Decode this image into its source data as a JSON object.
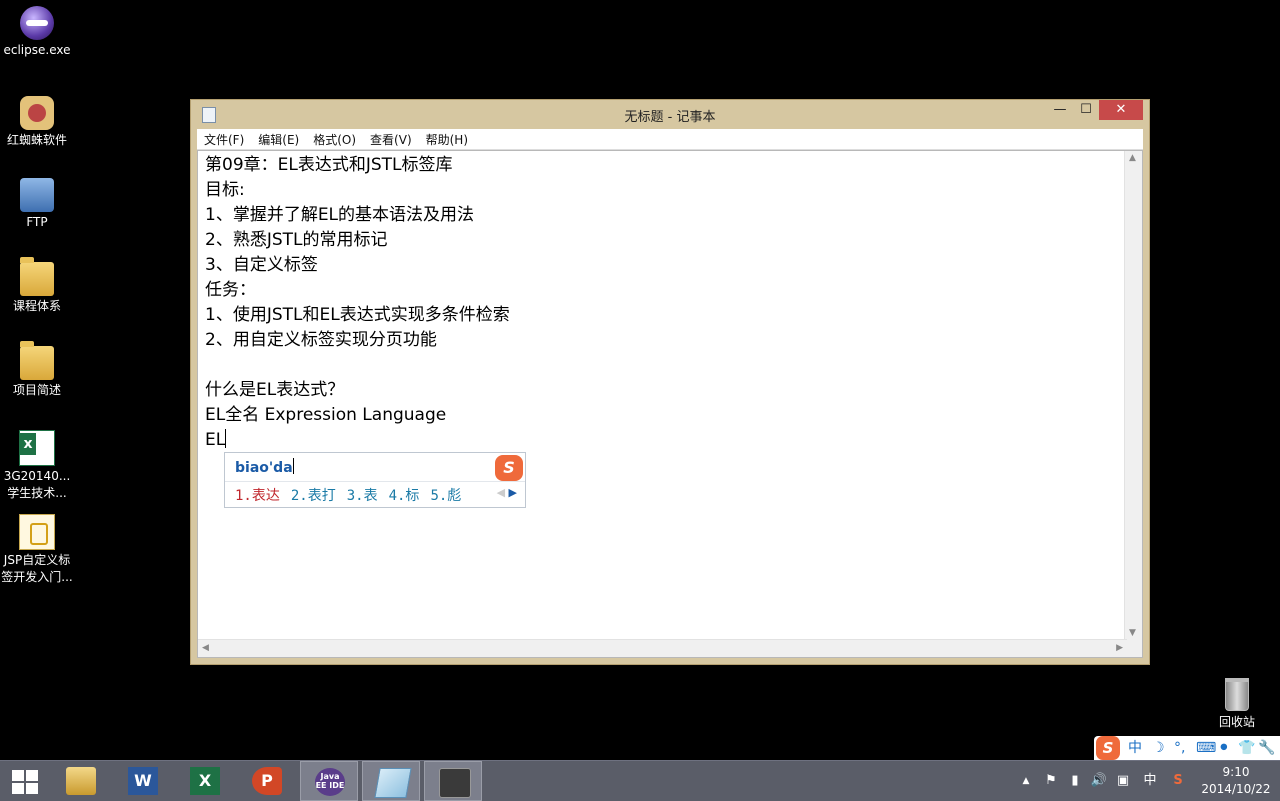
{
  "desktop": {
    "icons": [
      {
        "label": "eclipse.exe"
      },
      {
        "label": "红蜘蛛软件"
      },
      {
        "label": "FTP"
      },
      {
        "label": "课程体系"
      },
      {
        "label": "项目简述"
      },
      {
        "label": "3G20140...\n学生技术..."
      },
      {
        "label": "JSP自定义标\n签开发入门..."
      }
    ],
    "recycle_bin": {
      "label": "回收站"
    }
  },
  "window": {
    "title": "无标题 - 记事本",
    "buttons": {
      "minimize": "—",
      "maximize": "☐",
      "close": "✕"
    },
    "menu": [
      "文件(F)",
      "编辑(E)",
      "格式(O)",
      "查看(V)",
      "帮助(H)"
    ],
    "content_lines": [
      "第09章：EL表达式和JSTL标签库",
      "目标:",
      "1、掌握并了解EL的基本语法及用法",
      "2、熟悉JSTL的常用标记",
      "3、自定义标签",
      "任务：",
      "1、使用JSTL和EL表达式实现多条件检索",
      "2、用自定义标签实现分页功能",
      "",
      "什么是EL表达式？",
      "EL全名 Expression Language",
      "EL"
    ]
  },
  "ime": {
    "input": "biao'da",
    "logo": "S",
    "candidates": [
      "1.表达",
      "2.表打",
      "3.表",
      "4.标",
      "5.彪"
    ],
    "selected_index": 0,
    "prev_arrow": "◀",
    "next_arrow": "▶"
  },
  "ime_toolbar": {
    "logo": "S",
    "items": [
      "中",
      "☽",
      "°,",
      "⌨",
      "⚫",
      "👕",
      "🔧"
    ]
  },
  "taskbar": {
    "apps": [
      {
        "name": "File Explorer",
        "active": false
      },
      {
        "name": "Word",
        "glyph": "W",
        "active": false
      },
      {
        "name": "Excel",
        "glyph": "X",
        "active": false
      },
      {
        "name": "PowerPoint",
        "glyph": "P",
        "active": false
      },
      {
        "name": "Java EE IDE",
        "glyph": "Java EE IDE",
        "active": true
      },
      {
        "name": "Notepad",
        "active": true
      },
      {
        "name": "Tool",
        "active": false
      }
    ],
    "tray": [
      "▲",
      "⚑",
      "▮",
      "🔊",
      "▣",
      "中",
      "S"
    ],
    "time": "9:10",
    "date": "2014/10/22"
  },
  "colors": {
    "window_frame": "#d6c7a1",
    "close_button": "#c74a4a",
    "taskbar": "#5a5d68",
    "ime_selected": "#c0272d",
    "ime_candidate": "#1a7aa6",
    "sogou_orange": "#ef6a3b"
  }
}
